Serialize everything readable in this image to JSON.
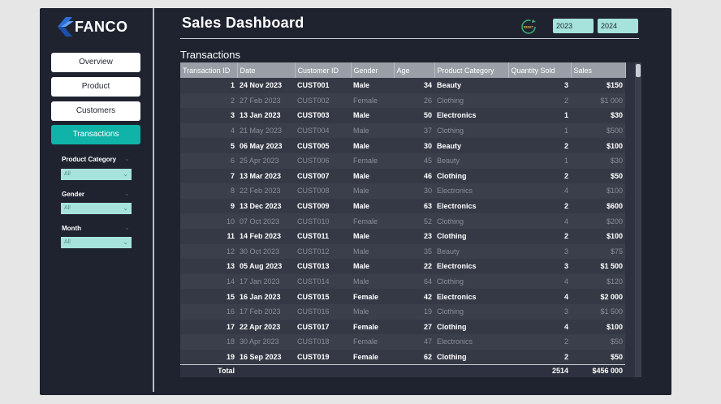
{
  "brand": {
    "name": "FANCO"
  },
  "nav": [
    {
      "label": "Overview"
    },
    {
      "label": "Product"
    },
    {
      "label": "Customers"
    },
    {
      "label": "Transactions"
    }
  ],
  "filters": [
    {
      "label": "Product Category",
      "value": "All"
    },
    {
      "label": "Gender",
      "value": "All"
    },
    {
      "label": "Month",
      "value": "All"
    }
  ],
  "header": {
    "title": "Sales Dashboard",
    "reset_label": "RESET",
    "years": [
      "2023",
      "2024"
    ]
  },
  "section": {
    "title": "Transactions"
  },
  "table": {
    "columns": [
      "Transaction ID",
      "Date",
      "Customer ID",
      "Gender",
      "Age",
      "Product Category",
      "Quantity Sold",
      "Sales"
    ],
    "rows": [
      [
        "1",
        "24 Nov 2023",
        "CUST001",
        "Male",
        "34",
        "Beauty",
        "3",
        "$150"
      ],
      [
        "2",
        "27 Feb 2023",
        "CUST002",
        "Female",
        "26",
        "Clothing",
        "2",
        "$1 000"
      ],
      [
        "3",
        "13 Jan 2023",
        "CUST003",
        "Male",
        "50",
        "Electronics",
        "1",
        "$30"
      ],
      [
        "4",
        "21 May 2023",
        "CUST004",
        "Male",
        "37",
        "Clothing",
        "1",
        "$500"
      ],
      [
        "5",
        "06 May 2023",
        "CUST005",
        "Male",
        "30",
        "Beauty",
        "2",
        "$100"
      ],
      [
        "6",
        "25 Apr 2023",
        "CUST006",
        "Female",
        "45",
        "Beauty",
        "1",
        "$30"
      ],
      [
        "7",
        "13 Mar 2023",
        "CUST007",
        "Male",
        "46",
        "Clothing",
        "2",
        "$50"
      ],
      [
        "8",
        "22 Feb 2023",
        "CUST008",
        "Male",
        "30",
        "Electronics",
        "4",
        "$100"
      ],
      [
        "9",
        "13 Dec 2023",
        "CUST009",
        "Male",
        "63",
        "Electronics",
        "2",
        "$600"
      ],
      [
        "10",
        "07 Oct 2023",
        "CUST010",
        "Female",
        "52",
        "Clothing",
        "4",
        "$200"
      ],
      [
        "11",
        "14 Feb 2023",
        "CUST011",
        "Male",
        "23",
        "Clothing",
        "2",
        "$100"
      ],
      [
        "12",
        "30 Oct 2023",
        "CUST012",
        "Male",
        "35",
        "Beauty",
        "3",
        "$75"
      ],
      [
        "13",
        "05 Aug 2023",
        "CUST013",
        "Male",
        "22",
        "Electronics",
        "3",
        "$1 500"
      ],
      [
        "14",
        "17 Jan 2023",
        "CUST014",
        "Male",
        "64",
        "Clothing",
        "4",
        "$120"
      ],
      [
        "15",
        "16 Jan 2023",
        "CUST015",
        "Female",
        "42",
        "Electronics",
        "4",
        "$2 000"
      ],
      [
        "16",
        "17 Feb 2023",
        "CUST016",
        "Male",
        "19",
        "Clothing",
        "3",
        "$1 500"
      ],
      [
        "17",
        "22 Apr 2023",
        "CUST017",
        "Female",
        "27",
        "Clothing",
        "4",
        "$100"
      ],
      [
        "18",
        "30 Apr 2023",
        "CUST018",
        "Female",
        "47",
        "Electronics",
        "2",
        "$50"
      ],
      [
        "19",
        "16 Sep 2023",
        "CUST019",
        "Female",
        "62",
        "Clothing",
        "2",
        "$50"
      ]
    ],
    "total": {
      "label": "Total",
      "quantity": "2514",
      "sales": "$456 000"
    }
  },
  "colors": {
    "frame": "#1f2330",
    "accent": "#0fb3a8",
    "filter_bg": "#a6e3dd",
    "header_bg": "#9a9ea6"
  }
}
